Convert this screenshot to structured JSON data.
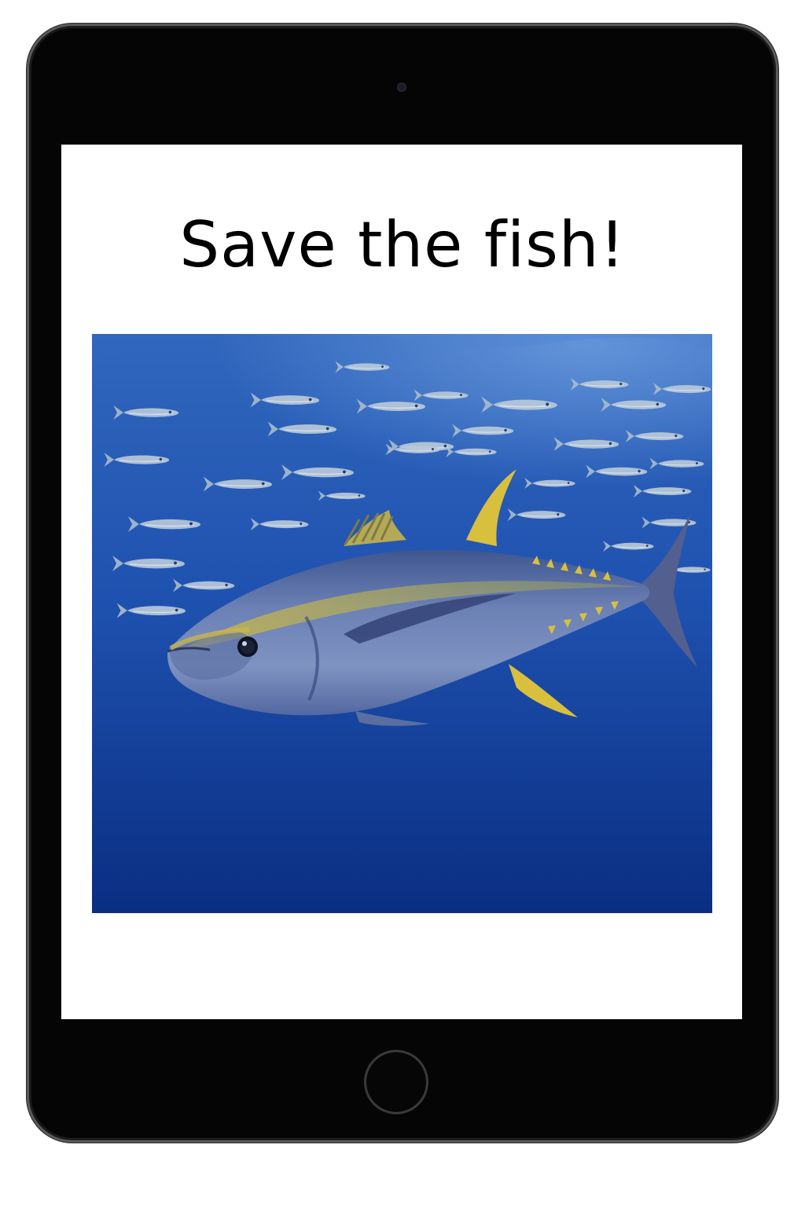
{
  "screen": {
    "headline": "Save the fish!"
  },
  "photo": {
    "subject": "tuna-with-school-of-fish",
    "colors": {
      "water_top": "#2f62b8",
      "water_bottom": "#0b2f85",
      "tuna_body": "#5c74a8",
      "tuna_stripe": "#b8a84a",
      "fin_yellow": "#e0c33c"
    }
  },
  "icons": {
    "camera": "camera-icon",
    "home": "home-button-icon"
  }
}
